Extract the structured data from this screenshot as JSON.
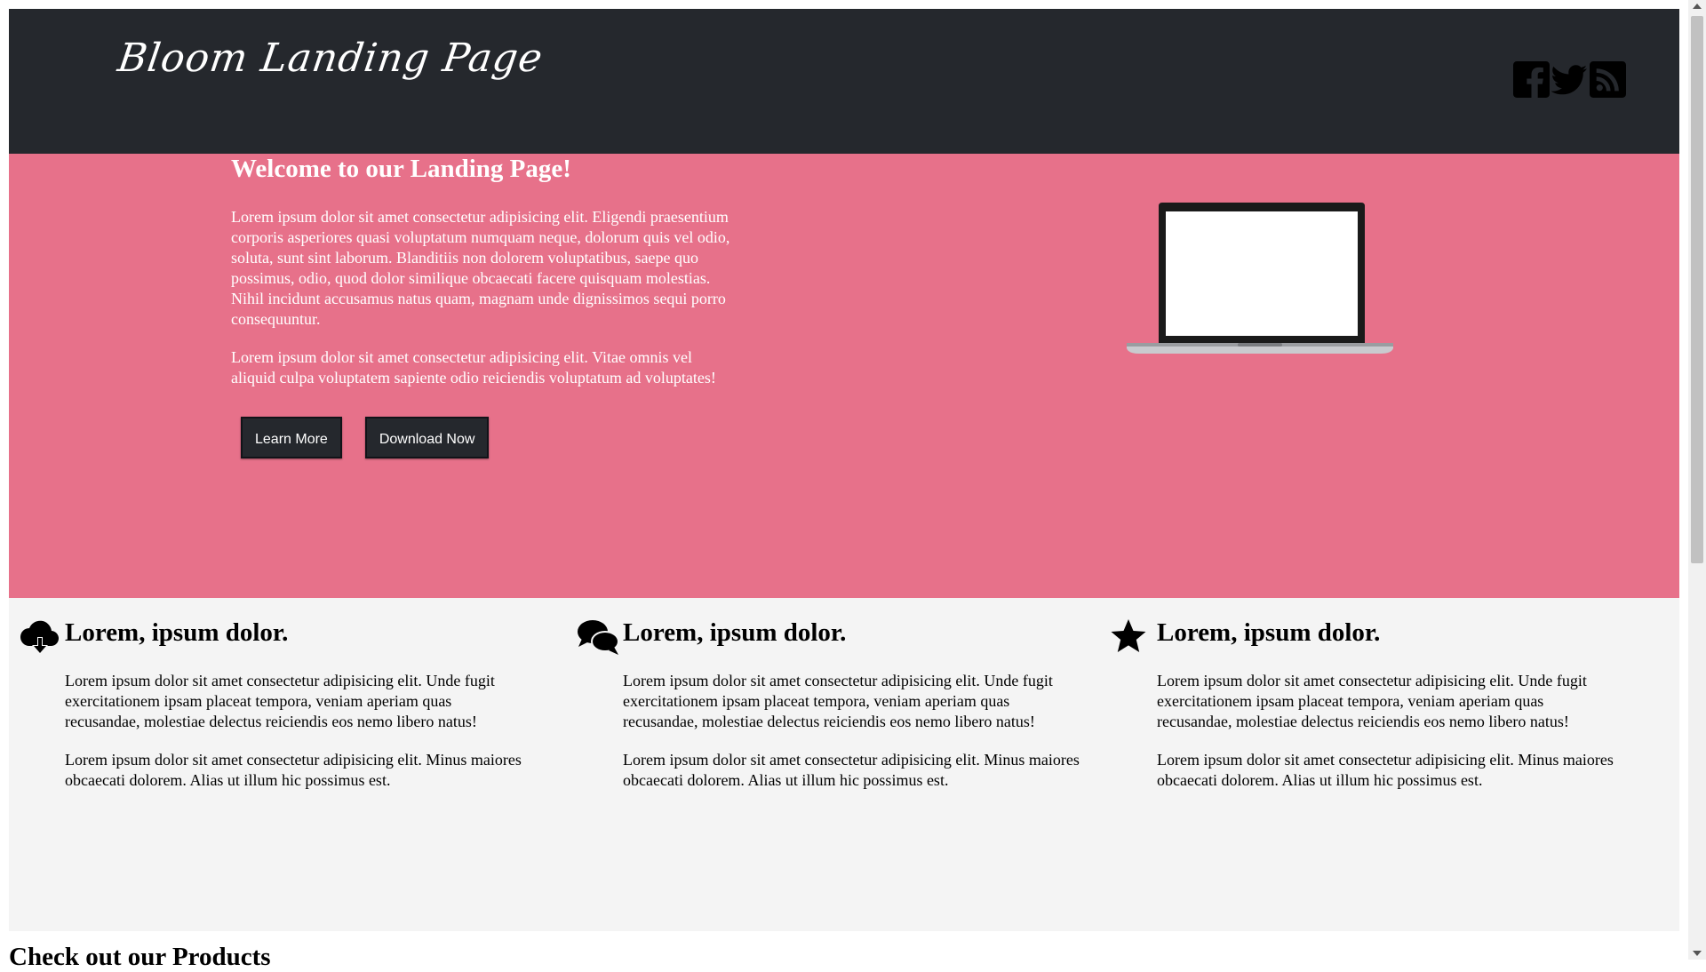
{
  "header": {
    "logo": "Bloom Landing Page",
    "social_icons": [
      "facebook-icon",
      "twitter-icon",
      "rss-icon"
    ]
  },
  "hero": {
    "title": "Welcome to our Landing Page!",
    "paragraph1": "Lorem ipsum dolor sit amet consectetur adipisicing elit. Eligendi praesentium corporis asperiores quasi voluptatum numquam neque, dolorum quis vel odio, soluta, sunt sint laborum. Blanditiis non dolorem voluptatibus, saepe quo possimus, odio, quod dolor similique obcaecati facere quisquam molestias. Nihil incidunt accusamus natus quam, magnam unde dignissimos sequi porro consequuntur.",
    "paragraph2": "Lorem ipsum dolor sit amet consectetur adipisicing elit. Vitae omnis vel aliquid culpa voluptatem sapiente odio reiciendis voluptatum ad voluptates!",
    "learn_more": "Learn More",
    "download_now": "Download Now",
    "image": "laptop-image"
  },
  "features": [
    {
      "icon": "cloud-download-icon",
      "title": "Lorem, ipsum dolor.",
      "p1": "Lorem ipsum dolor sit amet consectetur adipisicing elit. Unde fugit exercitationem ipsam placeat tempora, veniam aperiam quas recusandae, molestiae delectus reiciendis eos nemo libero natus!",
      "p2": "Lorem ipsum dolor sit amet consectetur adipisicing elit. Minus maiores obcaecati dolorem. Alias ut illum hic possimus est."
    },
    {
      "icon": "chat-bubbles-icon",
      "title": "Lorem, ipsum dolor.",
      "p1": "Lorem ipsum dolor sit amet consectetur adipisicing elit. Unde fugit exercitationem ipsam placeat tempora, veniam aperiam quas recusandae, molestiae delectus reiciendis eos nemo libero natus!",
      "p2": "Lorem ipsum dolor sit amet consectetur adipisicing elit. Minus maiores obcaecati dolorem. Alias ut illum hic possimus est."
    },
    {
      "icon": "star-icon",
      "title": "Lorem, ipsum dolor.",
      "p1": "Lorem ipsum dolor sit amet consectetur adipisicing elit. Unde fugit exercitationem ipsam placeat tempora, veniam aperiam quas recusandae, molestiae delectus reiciendis eos nemo libero natus!",
      "p2": "Lorem ipsum dolor sit amet consectetur adipisicing elit. Minus maiores obcaecati dolorem. Alias ut illum hic possimus est."
    }
  ],
  "next_section": {
    "title": "Check out our Products"
  },
  "colors": {
    "header_bg": "#25282d",
    "hero_bg": "#e7718a",
    "features_bg": "#f4f4f4",
    "button_bg": "#25282d"
  }
}
